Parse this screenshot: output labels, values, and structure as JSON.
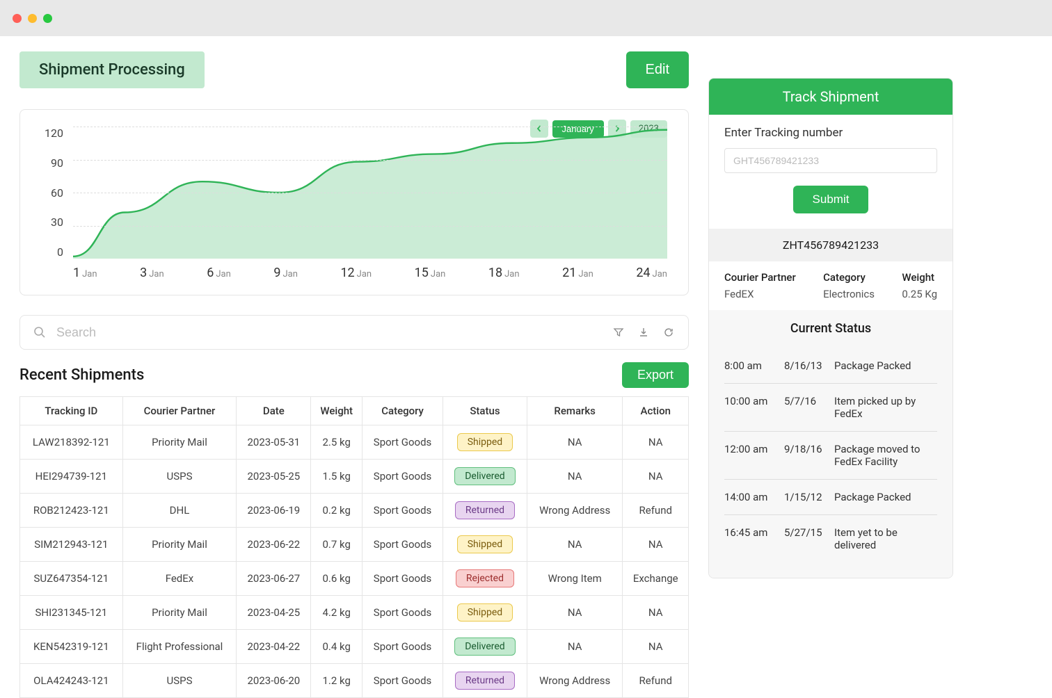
{
  "colors": {
    "primary": "#2fb457",
    "primaryLight": "#c2e9cf"
  },
  "page": {
    "title": "Shipment Processing",
    "editLabel": "Edit"
  },
  "chartControls": {
    "month": "January",
    "year": "2023"
  },
  "chart_data": {
    "type": "area",
    "title": "",
    "xlabel": "",
    "ylabel": "",
    "ylim": [
      0,
      120
    ],
    "x": [
      1,
      3,
      6,
      9,
      12,
      15,
      18,
      21,
      24
    ],
    "x_suffix": "Jan",
    "values": [
      2,
      42,
      70,
      60,
      88,
      95,
      105,
      110,
      117
    ]
  },
  "search": {
    "placeholder": "Search"
  },
  "table": {
    "title": "Recent Shipments",
    "exportLabel": "Export",
    "columns": [
      "Tracking ID",
      "Courier Partner",
      "Date",
      "Weight",
      "Category",
      "Status",
      "Remarks",
      "Action"
    ],
    "rows": [
      {
        "id": "LAW218392-121",
        "courier": "Priority Mail",
        "date": "2023-05-31",
        "weight": "2.5 kg",
        "category": "Sport Goods",
        "status": "Shipped",
        "remarks": "NA",
        "action": "NA"
      },
      {
        "id": "HEI294739-121",
        "courier": "USPS",
        "date": "2023-05-25",
        "weight": "1.5 kg",
        "category": "Sport Goods",
        "status": "Delivered",
        "remarks": "NA",
        "action": "NA"
      },
      {
        "id": "ROB212423-121",
        "courier": "DHL",
        "date": "2023-06-19",
        "weight": "0.2 kg",
        "category": "Sport Goods",
        "status": "Returned",
        "remarks": "Wrong Address",
        "action": "Refund"
      },
      {
        "id": "SIM212943-121",
        "courier": "Priority Mail",
        "date": "2023-06-22",
        "weight": "0.7 kg",
        "category": "Sport Goods",
        "status": "Shipped",
        "remarks": "NA",
        "action": "NA"
      },
      {
        "id": "SUZ647354-121",
        "courier": "FedEx",
        "date": "2023-06-27",
        "weight": "0.6 kg",
        "category": "Sport Goods",
        "status": "Rejected",
        "remarks": "Wrong Item",
        "action": "Exchange"
      },
      {
        "id": "SHI231345-121",
        "courier": "Priority Mail",
        "date": "2023-04-25",
        "weight": "4.2 kg",
        "category": "Sport Goods",
        "status": "Shipped",
        "remarks": "NA",
        "action": "NA"
      },
      {
        "id": "KEN542319-121",
        "courier": "Flight Professional",
        "date": "2023-04-22",
        "weight": "0.4 kg",
        "category": "Sport Goods",
        "status": "Delivered",
        "remarks": "NA",
        "action": "NA"
      },
      {
        "id": "OLA424243-121",
        "courier": "USPS",
        "date": "2023-06-20",
        "weight": "1.2 kg",
        "category": "Sport Goods",
        "status": "Returned",
        "remarks": "Wrong Address",
        "action": "Refund"
      }
    ]
  },
  "track": {
    "header": "Track Shipment",
    "label": "Enter Tracking number",
    "placeholder": "GHT456789421233",
    "submit": "Submit",
    "trackingId": "ZHT456789421233",
    "meta": {
      "courierPartnerLabel": "Courier Partner",
      "courierPartner": "FedEX",
      "categoryLabel": "Category",
      "category": "Electronics",
      "weightLabel": "Weight",
      "weight": "0.25 Kg"
    },
    "statusTitle": "Current Status",
    "statusRows": [
      {
        "time": "8:00 am",
        "date": "8/16/13",
        "desc": "Package Packed"
      },
      {
        "time": "10:00 am",
        "date": "5/7/16",
        "desc": "Item picked up by FedEx"
      },
      {
        "time": "12:00 am",
        "date": "9/18/16",
        "desc": "Package moved to FedEx Facility"
      },
      {
        "time": "14:00 am",
        "date": "1/15/12",
        "desc": "Package Packed"
      },
      {
        "time": "16:45 am",
        "date": "5/27/15",
        "desc": "Item yet to be delivered"
      }
    ]
  }
}
